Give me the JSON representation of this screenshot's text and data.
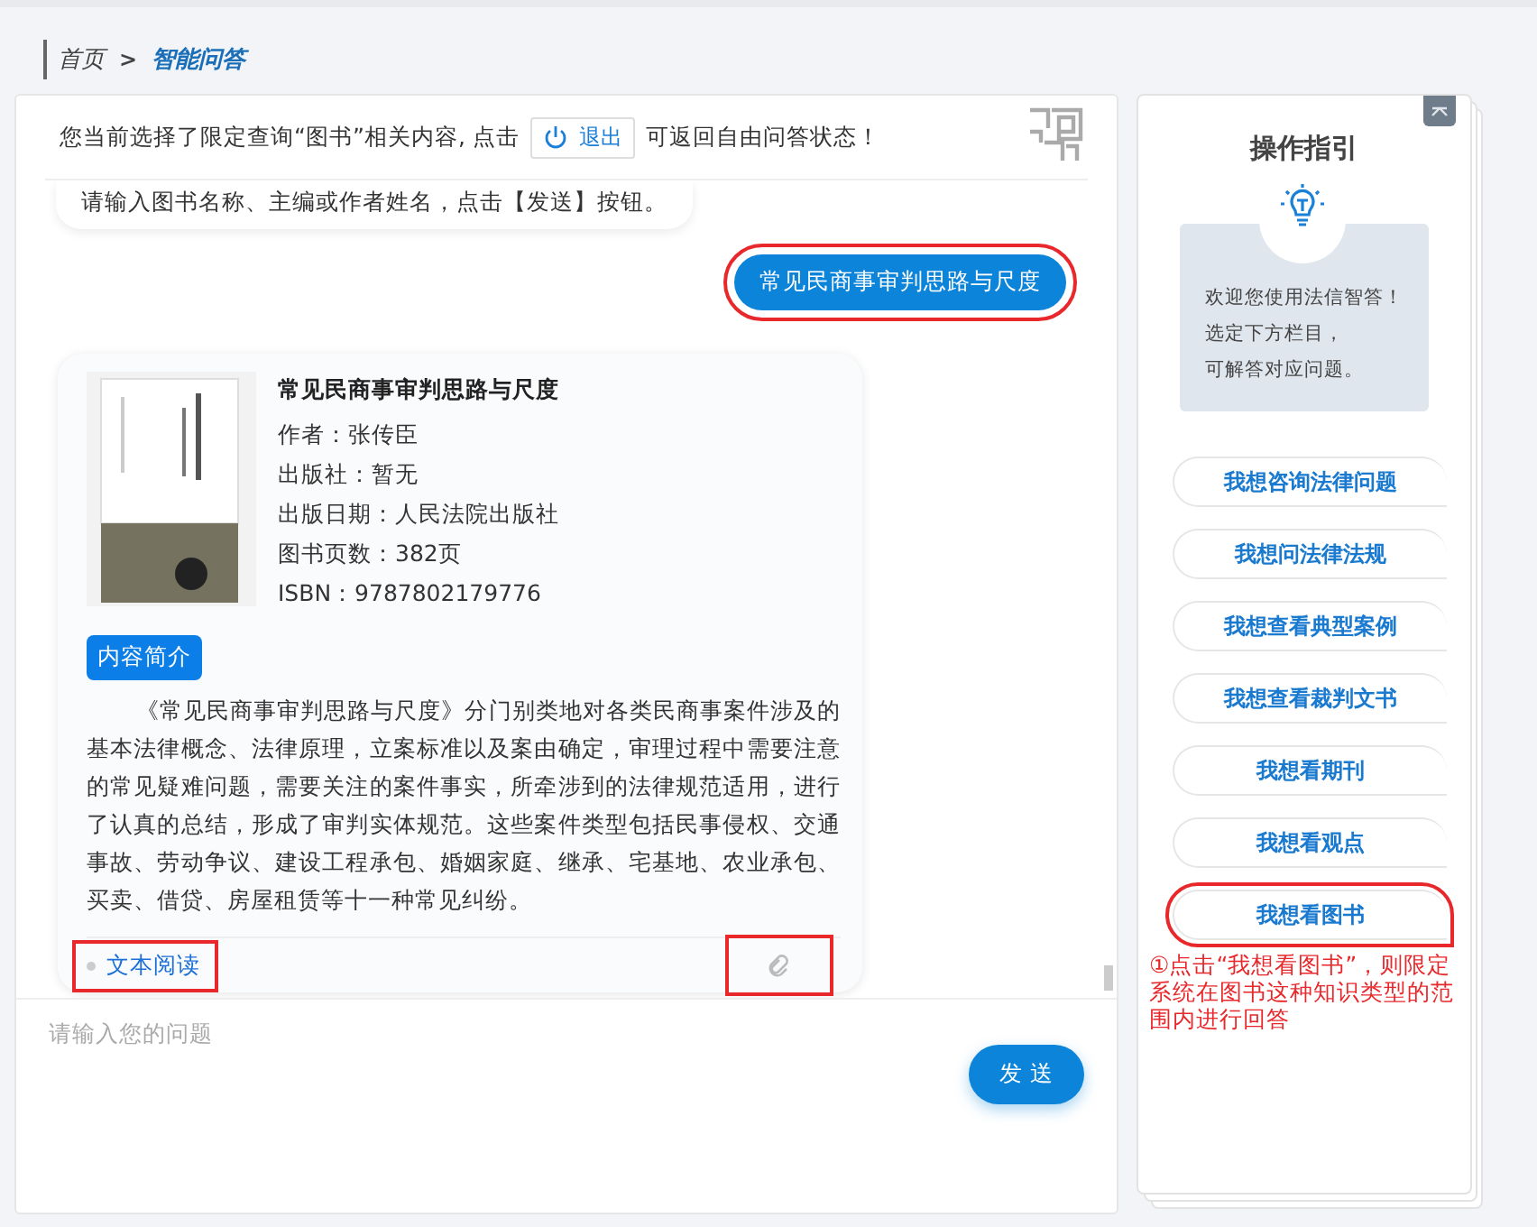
{
  "breadcrumb": [
    {
      "label": "首页",
      "selected": false
    },
    {
      "label": "智能问答",
      "selected": true
    }
  ],
  "breadcrumb_separator": ">",
  "notice": {
    "before": "您当前选择了限定查询“图书”相关内容, 点击",
    "button": "退出",
    "after": "可返回自由问答状态！"
  },
  "messages": [
    {
      "kind": "bot-text",
      "text": "请输入图书名称、主编或作者姓名，点击【发送】按钮。"
    },
    {
      "kind": "user",
      "text": "常见民商事审判思路与尺度",
      "annotated": true
    },
    {
      "kind": "book",
      "title": "常见民商事审判思路与尺度",
      "fields": [
        "作者：张传臣",
        "出版社：暂无",
        "出版日期：人民法院出版社",
        "图书页数：382页",
        "ISBN：9787802179776"
      ],
      "tag": "内容简介",
      "description": "《常见民商事审判思路与尺度》分门别类地对各类民商事案件涉及的基本法律概念、法律原理，立案标准以及案由确定，审理过程中需要注意的常见疑难问题，需要关注的案件事实，所牵涉到的法律规范适用，进行了认真的总结，形成了审判实体规范。这些案件类型包括民事侵权、交通事故、劳动争议、建设工程承包、婚姻家庭、继承、宅基地、农业承包、买卖、借贷、房屋租赁等十一种常见纠纷。",
      "read_link": "文本阅读",
      "read_annotated": true,
      "attach_annotated": true
    }
  ],
  "input": {
    "placeholder": "请输入您的问题",
    "send": "发 送"
  },
  "guide": {
    "title": "操作指引",
    "tips": [
      "欢迎您使用法信智答！",
      "选定下方栏目，",
      "可解答对应问题。"
    ],
    "options": [
      {
        "label": "我想咨询法律问题",
        "annotated": false
      },
      {
        "label": "我想问法律法规",
        "annotated": false
      },
      {
        "label": "我想查看典型案例",
        "annotated": false
      },
      {
        "label": "我想查看裁判文书",
        "annotated": false
      },
      {
        "label": "我想看期刊",
        "annotated": false
      },
      {
        "label": "我想看观点",
        "annotated": false
      },
      {
        "label": "我想看图书",
        "annotated": true
      }
    ],
    "annotation": "①点击“我想看图书”，则限定系统在图书这种知识类型的范围内进行回答"
  }
}
